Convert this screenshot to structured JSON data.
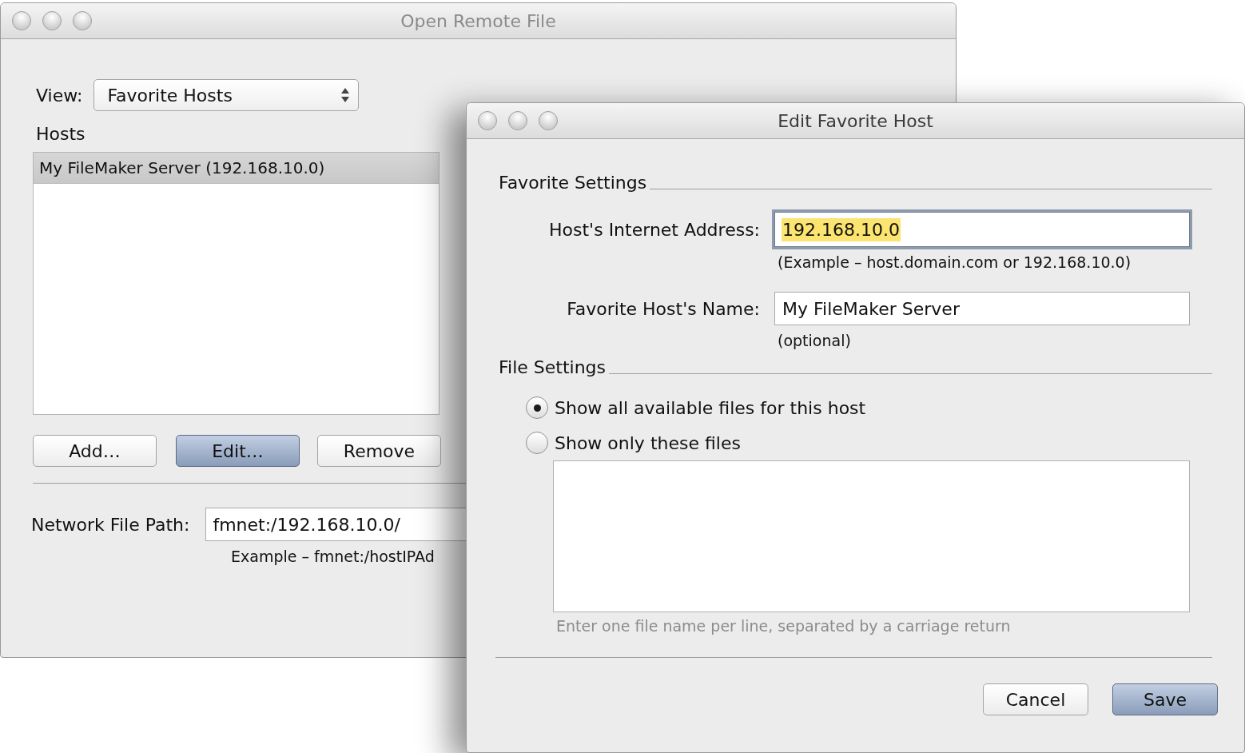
{
  "open_remote_file": {
    "title": "Open Remote File",
    "view_label": "View:",
    "view_select": {
      "value": "Favorite Hosts"
    },
    "hosts_label": "Hosts",
    "hosts": [
      {
        "label": "My FileMaker Server (192.168.10.0)",
        "selected": true
      }
    ],
    "buttons": [
      {
        "label": "Add…",
        "default": false
      },
      {
        "label": "Edit…",
        "default": true
      },
      {
        "label": "Remove",
        "default": false
      }
    ],
    "network_file_path": {
      "label": "Network File Path:",
      "value": "fmnet:/192.168.10.0/"
    },
    "example": "Example – fmnet:/hostIPAd"
  },
  "edit_favorite_host": {
    "title": "Edit Favorite Host",
    "favorite_settings": {
      "heading": "Favorite Settings",
      "address": {
        "label": "Host's Internet Address:",
        "value": "192.168.10.0",
        "focused": true
      },
      "address_note": "(Example – host.domain.com or 192.168.10.0)",
      "name": {
        "label": "Favorite Host's Name:",
        "value": "My FileMaker Server",
        "focused": false
      },
      "name_note": "(optional)"
    },
    "file_settings": {
      "heading": "File Settings",
      "options": [
        {
          "label": "Show all available files for this host",
          "selected": true
        },
        {
          "label": "Show only these files",
          "selected": false
        }
      ],
      "files_hint": "Enter one file name per line, separated by a carriage return"
    },
    "buttons": [
      {
        "label": "Cancel",
        "default": false
      },
      {
        "label": "Save",
        "default": true
      }
    ]
  }
}
